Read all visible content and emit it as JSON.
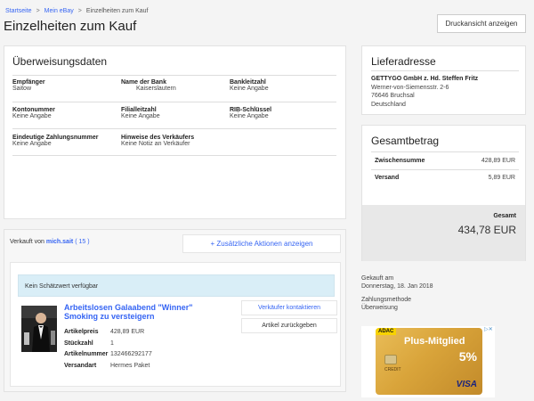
{
  "breadcrumb": {
    "items": [
      {
        "label": "Startseite",
        "link": true
      },
      {
        "label": "Mein eBay",
        "link": true
      },
      {
        "label": "Einzelheiten zum Kauf",
        "link": false
      }
    ]
  },
  "page_title": "Einzelheiten zum Kauf",
  "print_button": "Druckansicht anzeigen",
  "transfer": {
    "title": "Überweisungsdaten",
    "fields": [
      {
        "label": "Empfänger",
        "value": "Saitow"
      },
      {
        "label": "Name der Bank",
        "value": "Kaiserslautern"
      },
      {
        "label": "Bankleitzahl",
        "value": "Keine Angabe"
      },
      {
        "label": "Kontonummer",
        "value": "Keine Angabe"
      },
      {
        "label": "Filialleitzahl",
        "value": "Keine Angabe"
      },
      {
        "label": "RIB-Schlüssel",
        "value": "Keine Angabe"
      },
      {
        "label": "Eindeutige Zahlungsnummer",
        "value": "Keine Angabe"
      },
      {
        "label": "Hinweise des Verkäufers",
        "value": "Keine Notiz an Verkäufer"
      }
    ]
  },
  "seller": {
    "prefix": "Verkauft von",
    "name": "mich.sait",
    "rating": "( 15 )",
    "actions_button": "+ Zusätzliche Aktionen anzeigen"
  },
  "estimate_banner": "Kein Schätzwert verfügbar",
  "item": {
    "title": "Arbeitslosen Galaabend \"Winner\" Smoking zu versteigern",
    "details": [
      {
        "label": "Artikelpreis",
        "value": "428,89 EUR"
      },
      {
        "label": "Stückzahl",
        "value": "1"
      },
      {
        "label": "Artikelnummer",
        "value": "132466292177"
      },
      {
        "label": "Versandart",
        "value": "Hermes Paket"
      }
    ],
    "contact_button": "Verkäufer kontaktieren",
    "return_button": "Artikel zurückgeben"
  },
  "delivery": {
    "title": "Lieferadresse",
    "name": "GETTYGO GmbH z. Hd. Steffen Fritz",
    "street": "Werner-von-Siemensstr. 2-6",
    "city": "76646 Bruchsal",
    "country": "Deutschland"
  },
  "total": {
    "title": "Gesamtbetrag",
    "subtotal_label": "Zwischensumme",
    "subtotal_value": "428,89 EUR",
    "shipping_label": "Versand",
    "shipping_value": "5,89 EUR",
    "total_label": "Gesamt",
    "total_value": "434,78 EUR"
  },
  "purchase": {
    "bought_label": "Gekauft am",
    "bought_date": "Donnerstag, 18. Jan 2018",
    "method_label": "Zahlungsmethode",
    "method_value": "Überweisung"
  },
  "ad": {
    "brand": "ADAC",
    "headline": "Plus-Mitglied",
    "percent": "5%",
    "card_type": "CREDIT",
    "network": "VISA"
  },
  "colors": {
    "link": "#3665f3",
    "banner_bg": "#d9eef7",
    "ad_gold": "#d9a43a"
  }
}
